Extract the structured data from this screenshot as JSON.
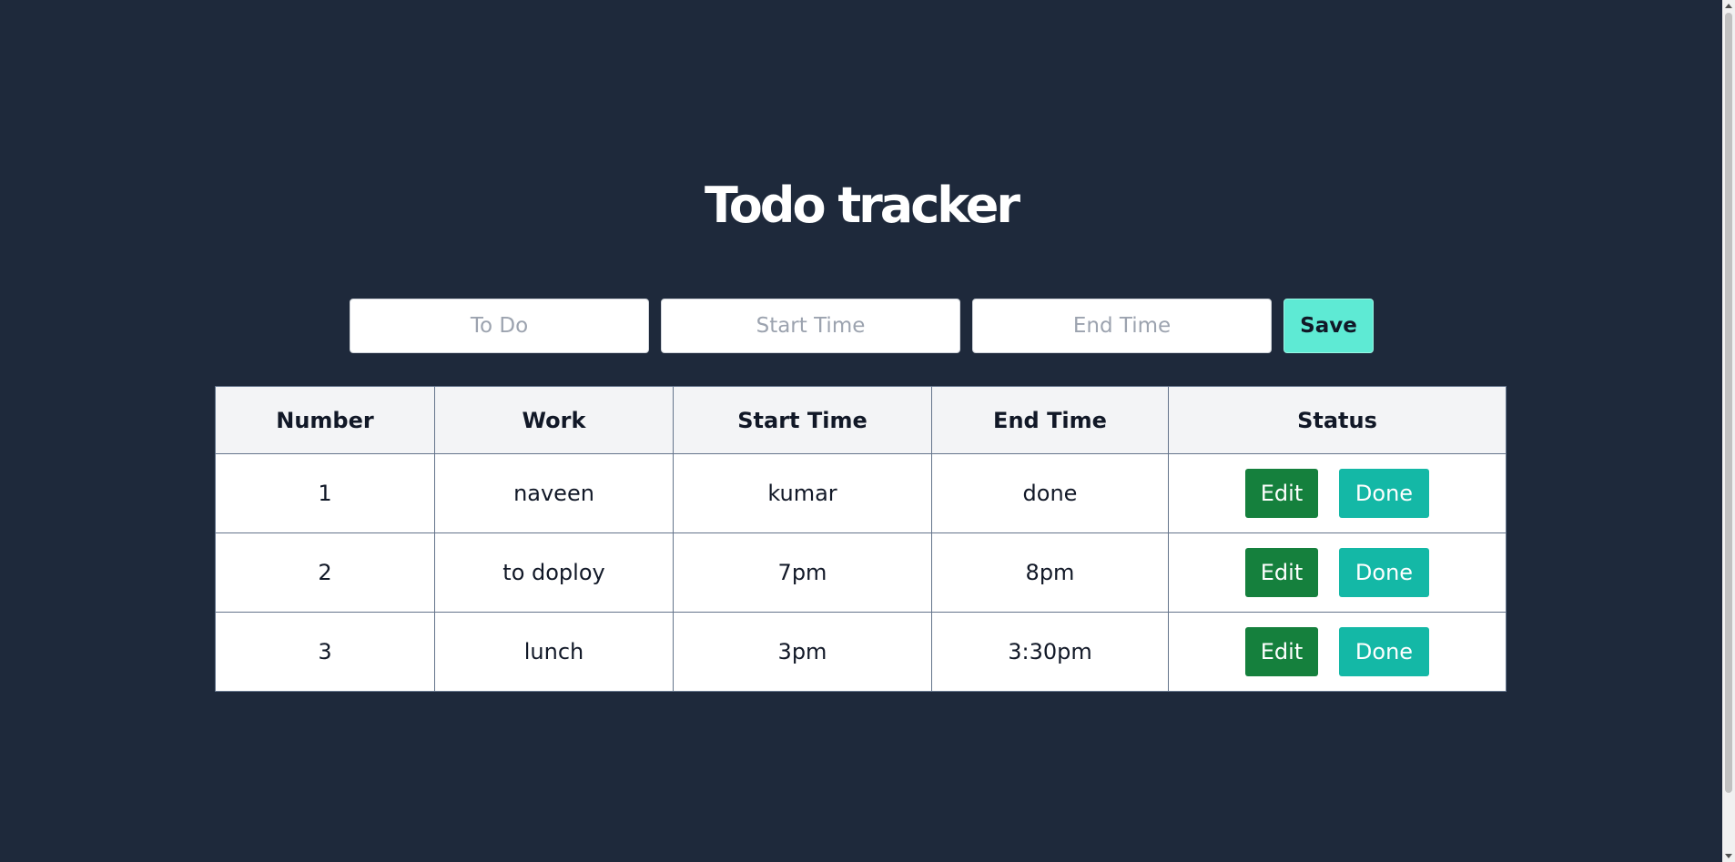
{
  "page": {
    "title": "Todo tracker"
  },
  "form": {
    "todo_placeholder": "To Do",
    "start_placeholder": "Start Time",
    "end_placeholder": "End Time",
    "save_label": "Save"
  },
  "table": {
    "headers": [
      "Number",
      "Work",
      "Start Time",
      "End Time",
      "Status"
    ],
    "rows": [
      {
        "number": "1",
        "work": "naveen",
        "start": "kumar",
        "end": "done",
        "edit_label": "Edit",
        "done_label": "Done"
      },
      {
        "number": "2",
        "work": "to doploy",
        "start": "7pm",
        "end": "8pm",
        "edit_label": "Edit",
        "done_label": "Done"
      },
      {
        "number": "3",
        "work": "lunch",
        "start": "3pm",
        "end": "3:30pm",
        "edit_label": "Edit",
        "done_label": "Done"
      }
    ]
  },
  "colors": {
    "background": "#1e293b",
    "save_button": "#5eead4",
    "edit_button": "#15803d",
    "done_button": "#14b8a6"
  }
}
